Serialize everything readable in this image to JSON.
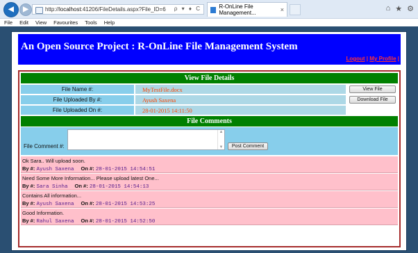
{
  "browser": {
    "url_prefix": "http://",
    "url_host": "localhost",
    "url_rest": ":41206/FileDetails.aspx?File_ID=6",
    "url_tools": "ρ ▾ ♦ C",
    "tab_title": "R-OnLine File Management...",
    "tab_close": "×",
    "menu": [
      "File",
      "Edit",
      "View",
      "Favourites",
      "Tools",
      "Help"
    ]
  },
  "banner": {
    "title": "An Open Source Project : R-OnLine File Management System",
    "logout": "Logout",
    "separator": "|",
    "profile": "My Profile",
    "separator_end": "|"
  },
  "file_details": {
    "heading": "View File Details",
    "rows": [
      {
        "label": "File Name #:",
        "value": "MyTestFile.docx",
        "action": "View File"
      },
      {
        "label": "File Uploaded By #:",
        "value": "Ayush Saxena",
        "action": "Download File"
      },
      {
        "label": "File Uploaded On #:",
        "value": "28-01-2015 14:11:50",
        "action": ""
      }
    ]
  },
  "comments": {
    "heading": "File Comments",
    "input_label": "File Comment #:",
    "input_value": "",
    "post_button": "Post Comment",
    "by_label": "By #:",
    "on_label": "On #:",
    "items": [
      {
        "text": "Ok Sara.. Will upload soon.",
        "by": "Ayush Saxena",
        "on": "28-01-2015 14:54:51"
      },
      {
        "text": "Need Some More Information... Please upload latest One...",
        "by": "Sara Sinha",
        "on": "28-01-2015 14:54:13"
      },
      {
        "text": "Contains All information...",
        "by": "Ayush Saxena",
        "on": "28-01-2015 14:53:25"
      },
      {
        "text": "Good Information.",
        "by": "Rahul Saxena",
        "on": "28-01-2015 14:52:50"
      }
    ]
  },
  "colors": {
    "banner_bg": "#0000ff",
    "section_header": "#008000",
    "label_cell": "#87ceeb",
    "value_cell": "#add8e6",
    "value_text": "#ff4500",
    "comment_bg": "#ffc0cb",
    "page_bg": "#2a4f72"
  }
}
